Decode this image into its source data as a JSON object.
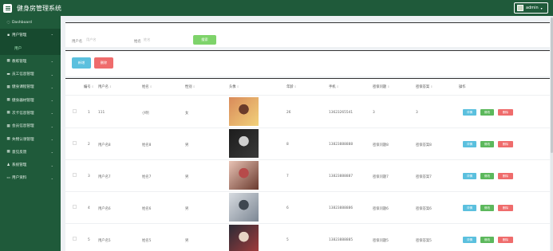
{
  "header": {
    "title": "健身房管理系统",
    "user": "admin"
  },
  "sidebar": {
    "items": [
      {
        "label": "Dashboard",
        "icon": "dashboard-icon",
        "glyph": "◌"
      },
      {
        "label": "用户管理",
        "icon": "comment-icon",
        "glyph": "▪",
        "expanded": true,
        "sub": "用户"
      },
      {
        "label": "教练管理",
        "icon": "grid-icon",
        "glyph": "▦"
      },
      {
        "label": "员工信息管理",
        "icon": "folder-icon",
        "glyph": "▬"
      },
      {
        "label": "健身课程管理",
        "icon": "grid-icon",
        "glyph": "▦"
      },
      {
        "label": "健身器材管理",
        "icon": "grid-icon",
        "glyph": "▦"
      },
      {
        "label": "次卡信息管理",
        "icon": "grid-icon",
        "glyph": "▦"
      },
      {
        "label": "会员信息管理",
        "icon": "grid-icon",
        "glyph": "▦"
      },
      {
        "label": "失物认领管理",
        "icon": "grid-icon",
        "glyph": "▦"
      },
      {
        "label": "意见反馈",
        "icon": "grid-icon",
        "glyph": "▦"
      },
      {
        "label": "系统管理",
        "icon": "user-icon",
        "glyph": "♟"
      },
      {
        "label": "用户资料",
        "icon": "card-icon",
        "glyph": "▭"
      }
    ]
  },
  "search": {
    "username_label": "用户名",
    "username_placeholder": "用户名",
    "name_label": "姓名",
    "name_placeholder": "姓名",
    "search_button": "搜索"
  },
  "actions": {
    "add": "新增",
    "delete": "删除"
  },
  "table": {
    "headers": [
      "编号",
      "用户名",
      "姓名",
      "性别",
      "头像",
      "年龄",
      "手机",
      "密保问题",
      "密保答案",
      "操作"
    ],
    "rows": [
      {
        "id": "1",
        "username": "111",
        "name": "小明",
        "gender": "女",
        "age": "26",
        "phone": "13623265541",
        "question": "3",
        "answer": "3",
        "photo": [
          "#d98a5a",
          "#f2d27a",
          "#6a3b2a"
        ]
      },
      {
        "id": "2",
        "username": "用户名8",
        "name": "姓名8",
        "gender": "男",
        "age": "8",
        "phone": "13823888888",
        "question": "密保问题8",
        "answer": "密保答案8",
        "photo": [
          "#1c1c1c",
          "#3a3a3a",
          "#cfcfcf"
        ]
      },
      {
        "id": "3",
        "username": "用户名7",
        "name": "姓名7",
        "gender": "男",
        "age": "7",
        "phone": "13823888887",
        "question": "密保问题7",
        "answer": "密保答案7",
        "photo": [
          "#e8c2b4",
          "#6a3a2e",
          "#b74a4a"
        ]
      },
      {
        "id": "4",
        "username": "用户名6",
        "name": "姓名6",
        "gender": "男",
        "age": "6",
        "phone": "13823888886",
        "question": "密保问题6",
        "answer": "密保答案6",
        "photo": [
          "#d7dbe0",
          "#7c8794",
          "#3f4750"
        ]
      },
      {
        "id": "5",
        "username": "用户名5",
        "name": "姓名5",
        "gender": "男",
        "age": "5",
        "phone": "13823888885",
        "question": "密保问题5",
        "answer": "密保答案5",
        "photo": [
          "#2b2b36",
          "#a33c3c",
          "#e6d3c4"
        ]
      }
    ],
    "ops": {
      "detail": "详情",
      "edit": "修改",
      "delete": "删除"
    }
  },
  "colors": {
    "brand": "#1f5a3a",
    "search_button": "#7ed36a",
    "add_button": "#5bc0de",
    "delete_button": "#ef6c6c"
  }
}
